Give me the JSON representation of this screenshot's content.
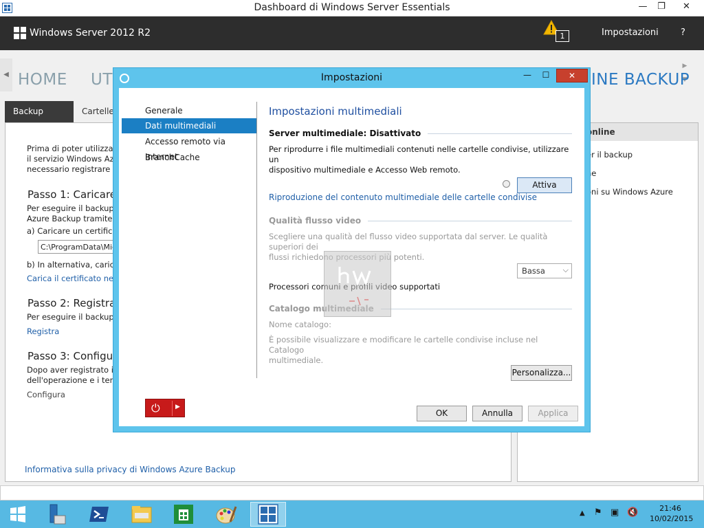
{
  "window": {
    "title": "Dashboard di Windows Server Essentials",
    "min": "—",
    "max": "❐",
    "close": "✕"
  },
  "header": {
    "brand": "Windows Server 2012 R2",
    "alert_count": "1",
    "settings": "Impostazioni",
    "help": "?"
  },
  "nav": {
    "home": "HOME",
    "utenti": "UTE",
    "backup": "INE BACKUP"
  },
  "tabs": {
    "active": "Backup online",
    "inactive": "Cartelle"
  },
  "left_panel": {
    "intro": [
      "Prima di poter utilizzare",
      "il servizio Windows Azu",
      "necessario registrare il s"
    ],
    "step1": "Passo 1: Caricare u",
    "step1_desc": [
      "Per eseguire il backup d",
      "Azure Backup tramite u"
    ],
    "step1_a": "a) Caricare un certificat",
    "path_value": "C:\\ProgramData\\Micro",
    "step1_b": "b) In alternativa, caricare u",
    "step1_link": "Carica il certificato nell'insie",
    "step2": "Passo 2: Registrar",
    "step2_desc": "Per eseguire il backup o",
    "step2_link": "Registra",
    "step3": "Passo 3: Configura",
    "step3_desc": [
      "Dopo aver registrato il s",
      "dell'operazione e i temp"
    ],
    "step3_action": "Configura",
    "privacy": "Informativa sulla privacy di Windows Azure Backup"
  },
  "right_panel": {
    "header": "online",
    "items": [
      "er il backup",
      "ne",
      "oni su Windows Azure"
    ]
  },
  "dialog": {
    "title": "Impostazioni",
    "nav": [
      "Generale",
      "Dati multimediali",
      "Accesso remoto via Internet",
      "BranchCache"
    ],
    "section_title": "Impostazioni multimediali",
    "server_group": "Server multimediale: Disattivato",
    "server_desc": [
      "Per riprodurre i file multimediali contenuti nelle cartelle condivise, utilizzare un",
      "dispositivo multimediale e Accesso Web remoto."
    ],
    "activate_button": "Attiva",
    "playback_link": "Riproduzione del contenuto multimediale delle cartelle condivise",
    "quality_group": "Qualità flusso video",
    "quality_desc": [
      "Scegliere una qualità del flusso video supportata dal server. Le qualità superiori dei",
      "flussi richiedono processori più potenti."
    ],
    "quality_value": "Bassa",
    "processors_text": "Processori comuni e profili video supportati",
    "catalog_group": "Catalogo multimediale",
    "catalog_name_label": "Nome catalogo:",
    "catalog_desc": [
      "È possibile visualizzare e modificare le cartelle condivise incluse nel Catalogo",
      "multimediale."
    ],
    "customize_button": "Personalizza...",
    "ok_button": "OK",
    "cancel_button": "Annulla",
    "apply_button": "Applica"
  },
  "taskbar": {
    "time": "21:46",
    "date": "10/02/2015"
  }
}
